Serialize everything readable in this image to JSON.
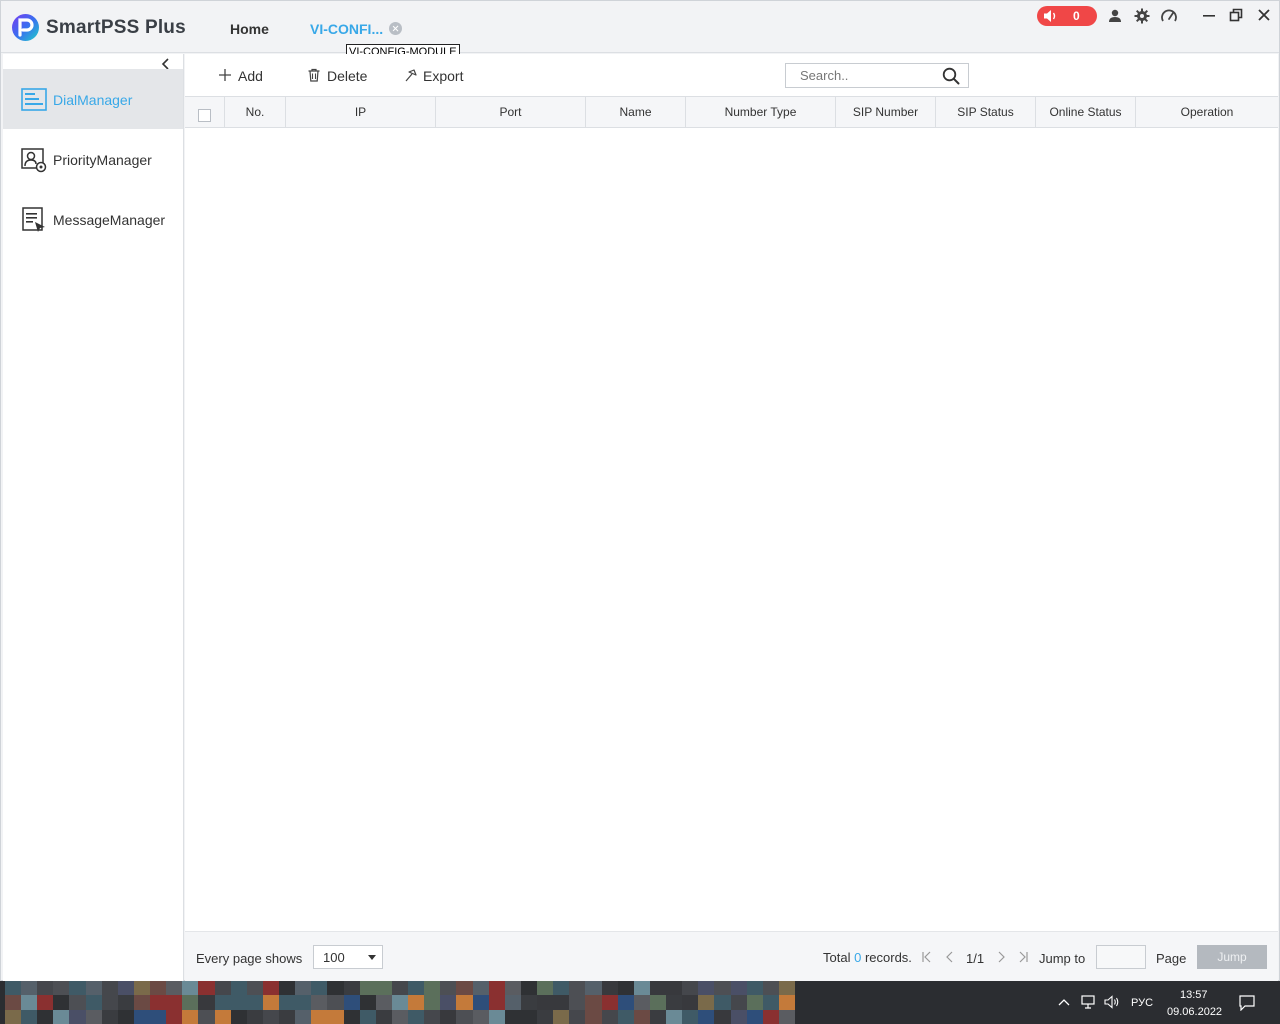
{
  "app": {
    "title": "SmartPSS Plus"
  },
  "tabs": [
    {
      "label": "Home"
    },
    {
      "label": "VI-CONFI..."
    }
  ],
  "tooltip": "VI-CONFIG-MODULE",
  "alarm": {
    "count": "0"
  },
  "colors": {
    "accent": "#38a8e8",
    "alarm": "#f04747"
  },
  "sidebar": {
    "items": [
      {
        "label": "DialManager",
        "icon": "dial-manager-icon",
        "active": true
      },
      {
        "label": "PriorityManager",
        "icon": "priority-manager-icon",
        "active": false
      },
      {
        "label": "MessageManager",
        "icon": "message-manager-icon",
        "active": false
      }
    ]
  },
  "toolbar": {
    "add_label": "Add",
    "delete_label": "Delete",
    "export_label": "Export",
    "search_placeholder": "Search.."
  },
  "table": {
    "columns": [
      "No.",
      "IP",
      "Port",
      "Name",
      "Number Type",
      "SIP Number",
      "SIP Status",
      "Online Status",
      "Operation"
    ],
    "rows": []
  },
  "footer": {
    "every_page_label": "Every page shows",
    "page_size": "100",
    "total_prefix": "Total",
    "total_count": "0",
    "total_suffix": "records.",
    "page_indicator": "1/1",
    "jump_to_label": "Jump to",
    "page_label": "Page",
    "jump_button": "Jump"
  },
  "taskbar": {
    "language": "РУС",
    "time": "13:57",
    "date": "09.06.2022"
  }
}
